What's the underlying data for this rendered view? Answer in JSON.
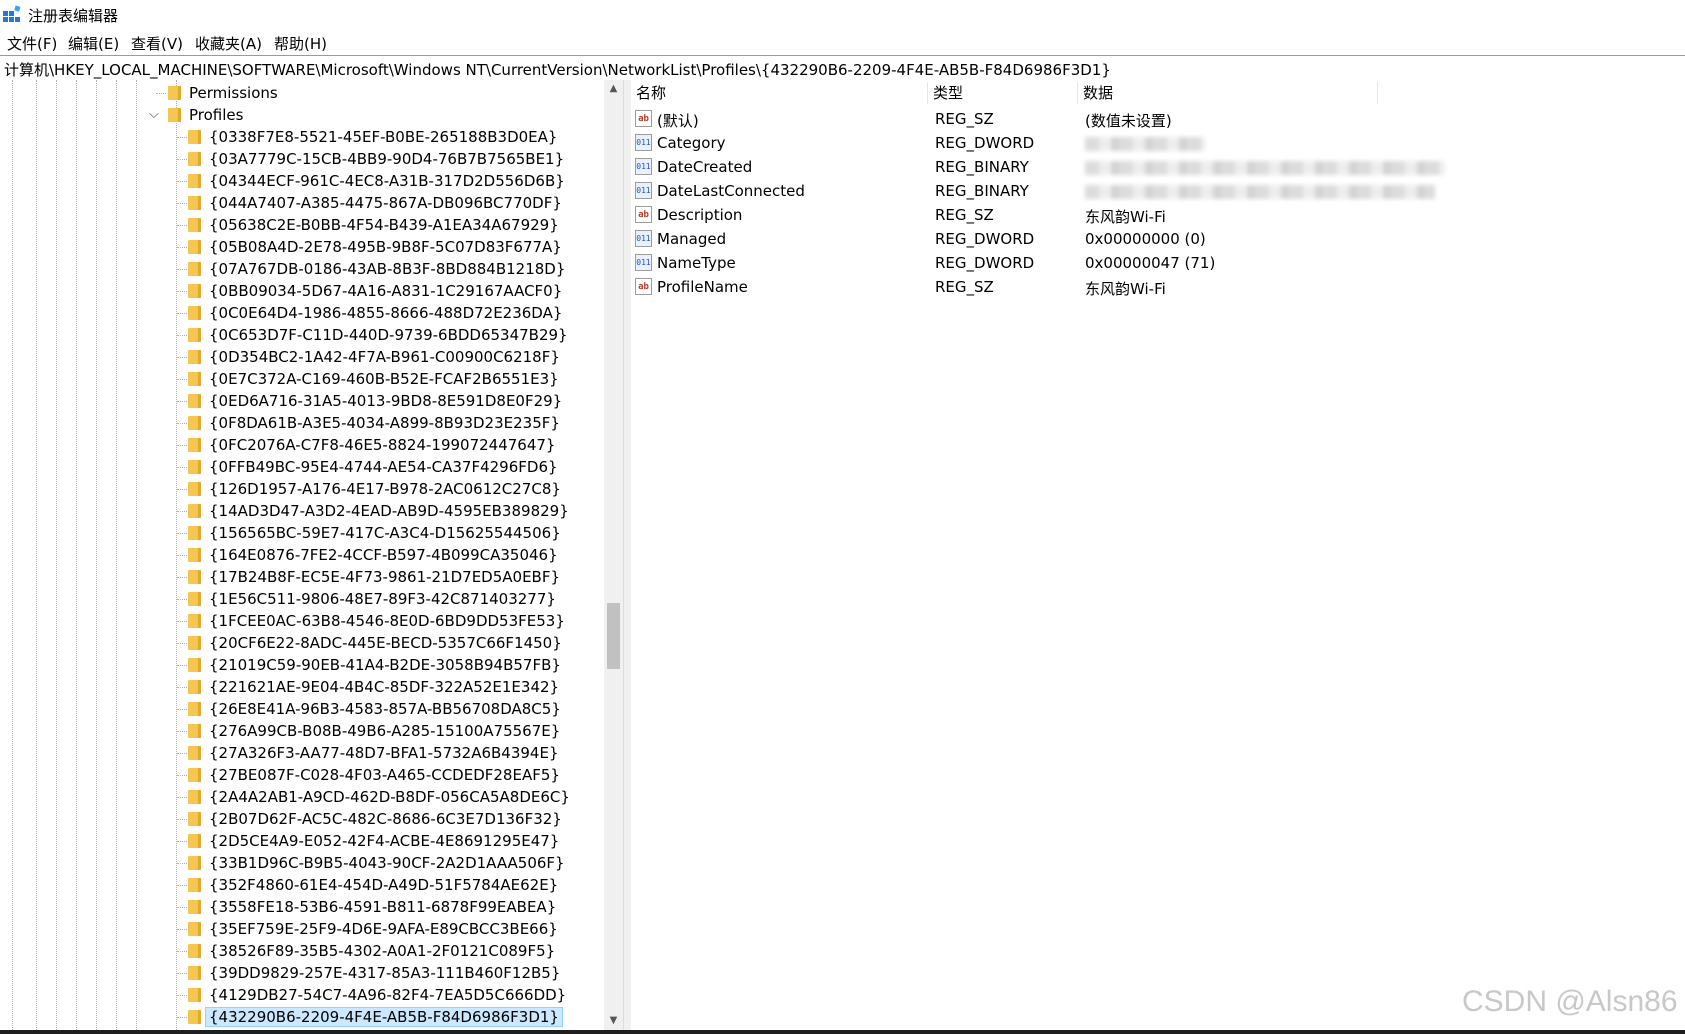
{
  "window": {
    "title": "注册表编辑器"
  },
  "menu": [
    "文件(F)",
    "编辑(E)",
    "查看(V)",
    "收藏夹(A)",
    "帮助(H)"
  ],
  "address": "计算机\\HKEY_LOCAL_MACHINE\\SOFTWARE\\Microsoft\\Windows NT\\CurrentVersion\\NetworkList\\Profiles\\{432290B6-2209-4F4E-AB5B-F84D6986F3D1}",
  "tree": {
    "permissions": "Permissions",
    "profiles": "Profiles",
    "keys": [
      "{0338F7E8-5521-45EF-B0BE-265188B3D0EA}",
      "{03A7779C-15CB-4BB9-90D4-76B7B7565BE1}",
      "{04344ECF-961C-4EC8-A31B-317D2D556D6B}",
      "{044A7407-A385-4475-867A-DB096BC770DF}",
      "{05638C2E-B0BB-4F54-B439-A1EA34A67929}",
      "{05B08A4D-2E78-495B-9B8F-5C07D83F677A}",
      "{07A767DB-0186-43AB-8B3F-8BD884B1218D}",
      "{0BB09034-5D67-4A16-A831-1C29167AACF0}",
      "{0C0E64D4-1986-4855-8666-488D72E236DA}",
      "{0C653D7F-C11D-440D-9739-6BDD65347B29}",
      "{0D354BC2-1A42-4F7A-B961-C00900C6218F}",
      "{0E7C372A-C169-460B-B52E-FCAF2B6551E3}",
      "{0ED6A716-31A5-4013-9BD8-8E591D8E0F29}",
      "{0F8DA61B-A3E5-4034-A899-8B93D23E235F}",
      "{0FC2076A-C7F8-46E5-8824-199072447647}",
      "{0FFB49BC-95E4-4744-AE54-CA37F4296FD6}",
      "{126D1957-A176-4E17-B978-2AC0612C27C8}",
      "{14AD3D47-A3D2-4EAD-AB9D-4595EB389829}",
      "{156565BC-59E7-417C-A3C4-D15625544506}",
      "{164E0876-7FE2-4CCF-B597-4B099CA35046}",
      "{17B24B8F-EC5E-4F73-9861-21D7ED5A0EBF}",
      "{1E56C511-9806-48E7-89F3-42C871403277}",
      "{1FCEE0AC-63B8-4546-8E0D-6BD9DD53FE53}",
      "{20CF6E22-8ADC-445E-BECD-5357C66F1450}",
      "{21019C59-90EB-41A4-B2DE-3058B94B57FB}",
      "{221621AE-9E04-4B4C-85DF-322A52E1E342}",
      "{26E8E41A-96B3-4583-857A-BB56708DA8C5}",
      "{276A99CB-B08B-49B6-A285-15100A75567E}",
      "{27A326F3-AA77-48D7-BFA1-5732A6B4394E}",
      "{27BE087F-C028-4F03-A465-CCDEDF28EAF5}",
      "{2A4A2AB1-A9CD-462D-B8DF-056CA5A8DE6C}",
      "{2B07D62F-AC5C-482C-8686-6C3E7D136F32}",
      "{2D5CE4A9-E052-42F4-ACBE-4E8691295E47}",
      "{33B1D96C-B9B5-4043-90CF-2A2D1AAA506F}",
      "{352F4860-61E4-454D-A49D-51F5784AE62E}",
      "{3558FE18-53B6-4591-B811-6878F99EABEA}",
      "{35EF759E-25F9-4D6E-9AFA-E89CBCC3BE66}",
      "{38526F89-35B5-4302-A0A1-2F0121C089F5}",
      "{39DD9829-257E-4317-85A3-111B460F12B5}",
      "{4129DB27-54C7-4A96-82F4-7EA5D5C666DD}",
      "{432290B6-2209-4F4E-AB5B-F84D6986F3D1}"
    ],
    "selected_index": 40
  },
  "columns": {
    "name": "名称",
    "type": "类型",
    "data": "数据"
  },
  "values": [
    {
      "name": "(默认)",
      "type": "REG_SZ",
      "data": "(数值未设置)",
      "icon": "string-value-icon"
    },
    {
      "name": "Category",
      "type": "REG_DWORD",
      "data": "",
      "icon": "binary-value-icon",
      "blurred": true
    },
    {
      "name": "DateCreated",
      "type": "REG_BINARY",
      "data": "",
      "icon": "binary-value-icon",
      "blurred": true
    },
    {
      "name": "DateLastConnected",
      "type": "REG_BINARY",
      "data": "",
      "icon": "binary-value-icon",
      "blurred": true
    },
    {
      "name": "Description",
      "type": "REG_SZ",
      "data": "东风韵Wi-Fi",
      "icon": "string-value-icon"
    },
    {
      "name": "Managed",
      "type": "REG_DWORD",
      "data": "0x00000000 (0)",
      "icon": "binary-value-icon"
    },
    {
      "name": "NameType",
      "type": "REG_DWORD",
      "data": "0x00000047 (71)",
      "icon": "binary-value-icon"
    },
    {
      "name": "ProfileName",
      "type": "REG_SZ",
      "data": "东风韵Wi-Fi",
      "icon": "string-value-icon"
    }
  ],
  "watermark": "CSDN @Alsn86"
}
